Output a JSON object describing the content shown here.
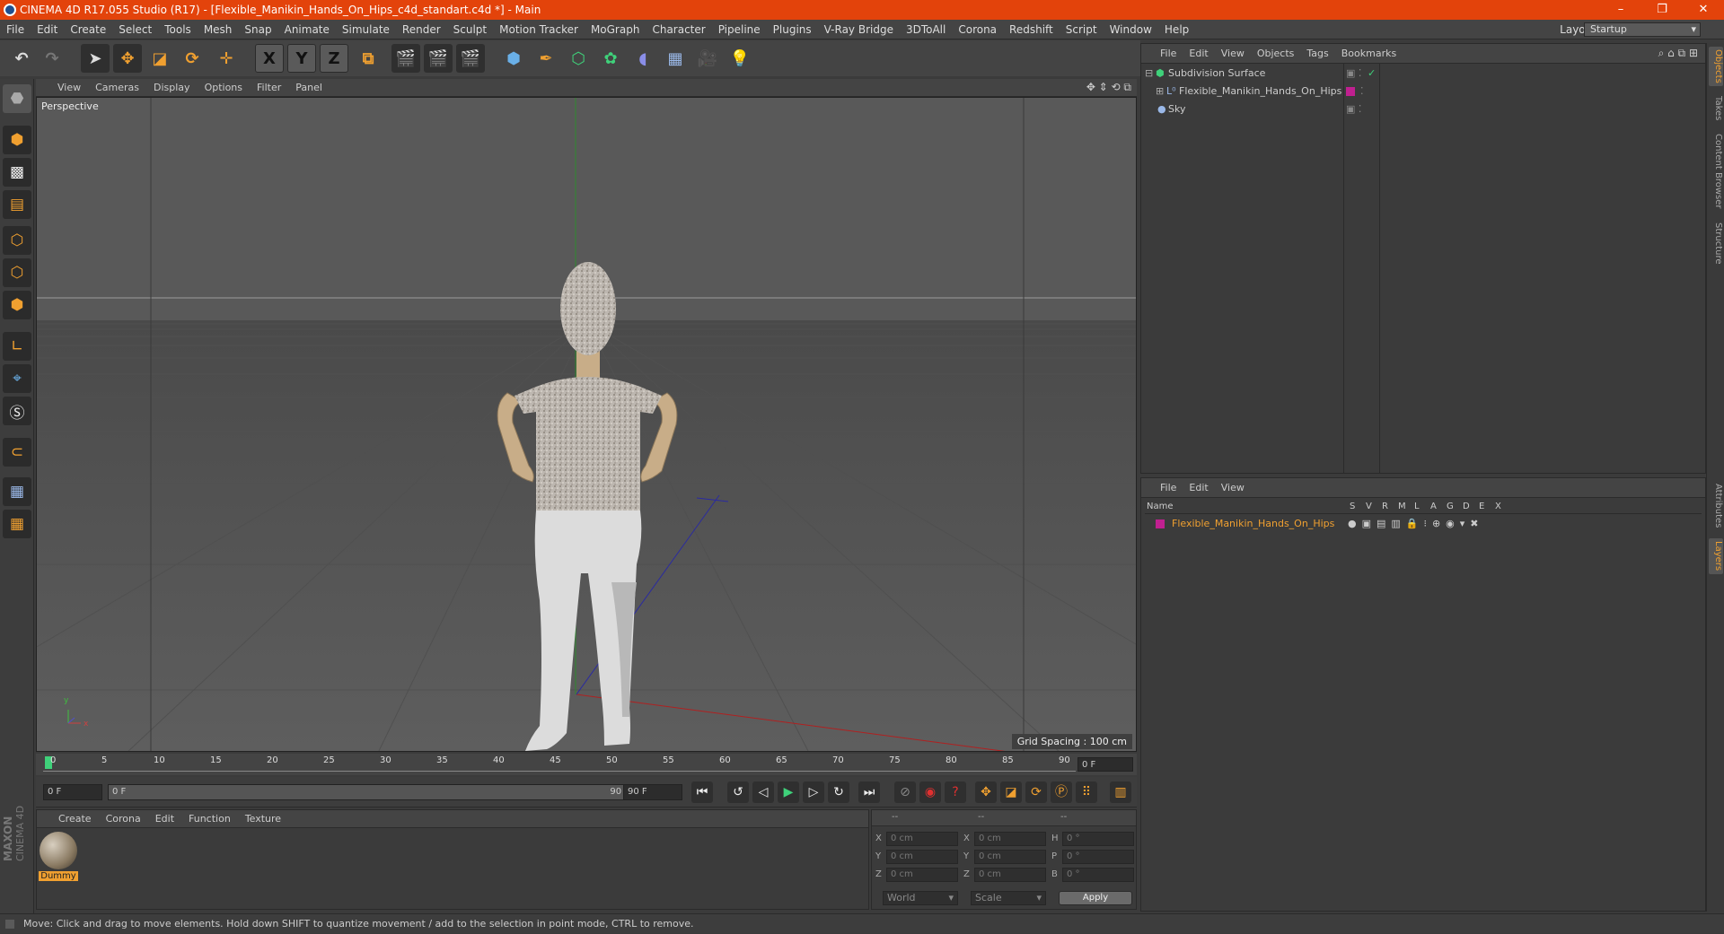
{
  "window": {
    "title": "CINEMA 4D R17.055 Studio (R17) - [Flexible_Manikin_Hands_On_Hips_c4d_standart.c4d *] - Main",
    "minimize": "–",
    "restore": "❐",
    "close": "✕"
  },
  "menubar": {
    "items": [
      "File",
      "Edit",
      "Create",
      "Select",
      "Tools",
      "Mesh",
      "Snap",
      "Animate",
      "Simulate",
      "Render",
      "Sculpt",
      "Motion Tracker",
      "MoGraph",
      "Character",
      "Pipeline",
      "Plugins",
      "V-Ray Bridge",
      "3DToAll",
      "Corona",
      "Redshift",
      "Script",
      "Window",
      "Help"
    ],
    "layout_label": "Layout:",
    "layout_value": "Startup"
  },
  "toolbar": {
    "axis_x": "X",
    "axis_y": "Y",
    "axis_z": "Z"
  },
  "viewport": {
    "menu": [
      "View",
      "Cameras",
      "Display",
      "Options",
      "Filter",
      "Panel"
    ],
    "label": "Perspective",
    "grid_spacing": "Grid Spacing : 100 cm",
    "axis_y": "y",
    "axis_x": "x"
  },
  "timeline": {
    "ticks": [
      "0",
      "5",
      "10",
      "15",
      "20",
      "25",
      "30",
      "35",
      "40",
      "45",
      "50",
      "55",
      "60",
      "65",
      "70",
      "75",
      "80",
      "85",
      "90"
    ],
    "current_frame": "0 F",
    "start_field": "0 F",
    "range_start": "0 F",
    "range_end": "90 F",
    "end_field": "90 F"
  },
  "material_panel": {
    "menu": [
      "Create",
      "Corona",
      "Edit",
      "Function",
      "Texture"
    ],
    "material_name": "Dummy"
  },
  "coord_panel": {
    "header1": "--",
    "header2": "--",
    "header3": "--",
    "rows": [
      {
        "l1": "X",
        "v1": "0 cm",
        "l2": "X",
        "v2": "0 cm",
        "l3": "H",
        "v3": "0 °"
      },
      {
        "l1": "Y",
        "v1": "0 cm",
        "l2": "Y",
        "v2": "0 cm",
        "l3": "P",
        "v3": "0 °"
      },
      {
        "l1": "Z",
        "v1": "0 cm",
        "l2": "Z",
        "v2": "0 cm",
        "l3": "B",
        "v3": "0 °"
      }
    ],
    "world": "World",
    "scale": "Scale",
    "apply": "Apply"
  },
  "object_manager": {
    "menu": [
      "File",
      "Edit",
      "View",
      "Objects",
      "Tags",
      "Bookmarks"
    ],
    "objects": [
      {
        "name": "Subdivision Surface"
      },
      {
        "name": "Flexible_Manikin_Hands_On_Hips"
      },
      {
        "name": "Sky"
      }
    ]
  },
  "layer_manager": {
    "menu": [
      "File",
      "Edit",
      "View"
    ],
    "col_name": "Name",
    "cols": [
      "S",
      "V",
      "R",
      "M",
      "L",
      "A",
      "G",
      "D",
      "E",
      "X"
    ],
    "layer_name": "Flexible_Manikin_Hands_On_Hips"
  },
  "right_tabs": {
    "objects": "Objects",
    "takes": "Takes",
    "content_browser": "Content Browser",
    "structure": "Structure",
    "attributes": "Attributes",
    "layers": "Layers"
  },
  "logo": {
    "line1": "MAXON",
    "line2": "CINEMA 4D"
  },
  "status": "Move: Click and drag to move elements. Hold down SHIFT to quantize movement / add to the selection in point mode, CTRL to remove.",
  "colors": {
    "accent": "#e3430b",
    "tool_orange": "#f0a030",
    "layer_color": "#c02090"
  }
}
